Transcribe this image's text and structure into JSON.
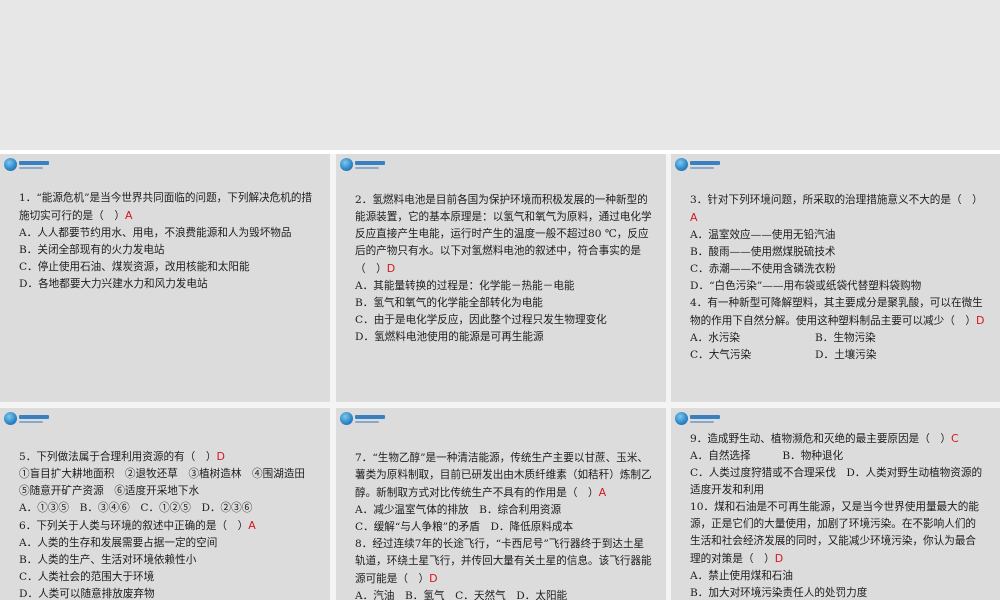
{
  "slides": [
    {
      "lines": [
        {
          "text": "1．“能源危机”是当今世界共同面临的问题，下列解决危机的措施切实可行的是（　）",
          "answer": "A"
        },
        {
          "text": "A．人人都要节约用水、用电，不浪费能源和人为毁坏物品"
        },
        {
          "text": "B．关闭全部现有的火力发电站"
        },
        {
          "text": "C．停止使用石油、煤炭资源，改用核能和太阳能"
        },
        {
          "text": "D．各地都要大力兴建水力和风力发电站"
        }
      ]
    },
    {
      "lines": [
        {
          "text": "2．氢燃料电池是目前各国为保护环境而积极发展的一种新型的能源装置，它的基本原理是：以氢气和氧气为原料，通过电化学反应直接产生电能，运行时产生的温度一般不超过80 ℃，反应后的产物只有水。以下对氢燃料电池的叙述中，符合事实的是（　）",
          "answer": "D"
        },
        {
          "text": "A．其能量转换的过程是：化学能－热能－电能"
        },
        {
          "text": "B．氢气和氧气的化学能全部转化为电能"
        },
        {
          "text": "C．由于是电化学反应，因此整个过程只发生物理变化"
        },
        {
          "text": "D．氢燃料电池使用的能源是可再生能源"
        }
      ]
    },
    {
      "lines": [
        {
          "text": "3．针对下列环境问题，所采取的治理措施意义不大的是（　）",
          "answer": "A"
        },
        {
          "text": "A．温室效应——使用无铅汽油"
        },
        {
          "text": "B．酸雨——使用燃煤脱硫技术"
        },
        {
          "text": "C．赤潮——不使用含磷洗衣粉"
        },
        {
          "text": "D．“白色污染”——用布袋或纸袋代替塑料袋购物"
        },
        {
          "text": "4．有一种新型可降解塑料，其主要成分是聚乳酸，可以在微生物的作用下自然分解。使用这种塑料制品主要可以减少（　）",
          "answer": "D"
        }
      ],
      "options": [
        [
          "A．水污染",
          "B．生物污染"
        ],
        [
          "C．大气污染",
          "D．土壤污染"
        ]
      ]
    },
    {
      "lines": [
        {
          "text": "5．下列做法属于合理利用资源的有（　）",
          "answer": "D"
        },
        {
          "text": "①盲目扩大耕地面积　②退牧还草　③植树造林　④围湖造田　⑤随意开矿产资源　⑥适度开采地下水"
        },
        {
          "text": "A．①③⑤　B．③④⑥　C．①②⑤　D．②③⑥"
        },
        {
          "text": "6．下列关于人类与环境的叙述中正确的是（　）",
          "answer": "A"
        },
        {
          "text": "A．人类的生存和发展需要占据一定的空间"
        },
        {
          "text": "B．人类的生产、生活对环境依赖性小"
        },
        {
          "text": "C．人类社会的范围大于环境"
        },
        {
          "text": "D．人类可以随意排放废弃物"
        }
      ]
    },
    {
      "lines": [
        {
          "text": "7．“生物乙醇”是一种清洁能源，传统生产主要以甘蔗、玉米、薯类为原料制取，目前已研发出由木质纤维素（如秸秆）炼制乙醇。新制取方式对比传统生产不具有的作用是（　）",
          "answer": "A"
        },
        {
          "text": "A．减少温室气体的排放　B．综合利用资源"
        },
        {
          "text": "C．缓解“与人争粮”的矛盾　D．降低原料成本"
        },
        {
          "text": "8．经过连续7年的长途飞行，“卡西尼号”飞行器终于到达土星轨道，环绕土星飞行，并传回大量有关土星的信息。该飞行器能源可能是（　）",
          "answer": "D"
        },
        {
          "text": "A．汽油　B．氢气　C．天然气　D．太阳能"
        }
      ]
    },
    {
      "lines": [
        {
          "text": "9．造成野生动、植物濒危和灭绝的最主要原因是（　）",
          "answer": "C"
        },
        {
          "text": "A．自然选择　　　B．物种退化"
        },
        {
          "text": "C．人类过度狩猎或不合理采伐　D．人类对野生动植物资源的适度开发和利用"
        },
        {
          "text": "10．煤和石油是不可再生能源，又是当今世界使用量最大的能源，正是它们的大量使用，加剧了环境污染。在不影响人们的生活和社会经济发展的同时，又能减少环境污染，你认为最合理的对策是（　）",
          "answer": "D"
        },
        {
          "text": "A．禁止使用煤和石油"
        },
        {
          "text": "B．加大对环境污染责任人的处罚力度"
        }
      ]
    }
  ]
}
